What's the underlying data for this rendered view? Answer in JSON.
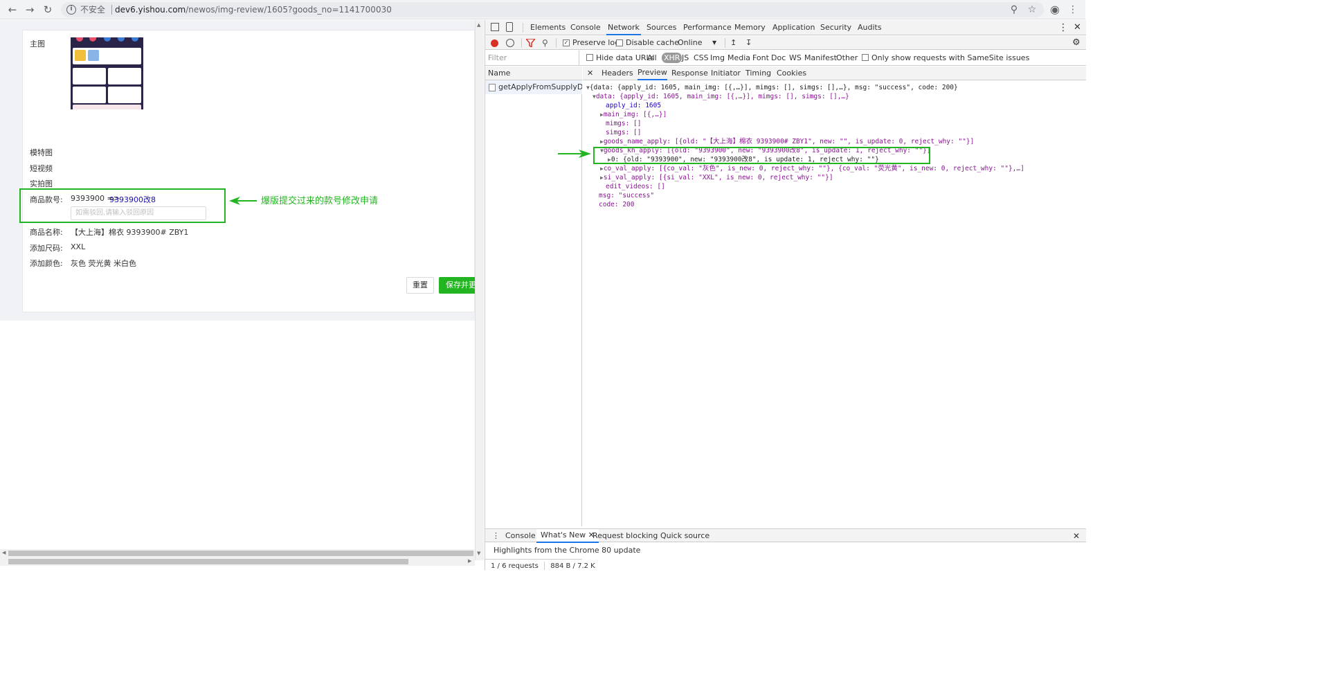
{
  "browser": {
    "insecure_label": "不安全",
    "url_host": "dev6.yishou.com",
    "url_path": "/newos/img-review/1605?goods_no=1141700030"
  },
  "form": {
    "main_image_label": "主图",
    "model_image_label": "模特图",
    "short_video_label": "短视频",
    "real_photo_label": "实拍图",
    "kh_label": "商品款号:",
    "kh_old": "9393900 =>",
    "kh_new": "9393900改8",
    "reject_placeholder": "如需驳回,请输入驳回原因",
    "name_label": "商品名称:",
    "name_value": "【大上海】棉衣 9393900# ZBY1",
    "size_label": "添加尺码:",
    "size_value": "XXL",
    "color_label": "添加颜色:",
    "color_value": "灰色 荧光黄 米白色",
    "reset_button": "重置",
    "save_button": "保存并更"
  },
  "annotation": {
    "text": "爆版提交过来的款号修改申请"
  },
  "devtools": {
    "tabs": [
      "Elements",
      "Console",
      "Network",
      "Sources",
      "Performance",
      "Memory",
      "Application",
      "Security",
      "Audits"
    ],
    "preserve_log": "Preserve log",
    "disable_cache": "Disable cache",
    "throttle": "Online",
    "filter_placeholder": "Filter",
    "hide_data_urls": "Hide data URLs",
    "type_filters": [
      "All",
      "XHR",
      "JS",
      "CSS",
      "Img",
      "Media",
      "Font",
      "Doc",
      "WS",
      "Manifest",
      "Other"
    ],
    "samesite": "Only show requests with SameSite issues",
    "name_header": "Name",
    "request_name": "getApplyFromSupplyDetail",
    "detail_tabs": [
      "Headers",
      "Preview",
      "Response",
      "Initiator",
      "Timing",
      "Cookies"
    ],
    "status_requests": "1 / 6 requests",
    "status_size": "884 B / 7.2 K",
    "drawer_tabs": [
      "Console",
      "What's New",
      "Request blocking",
      "Quick source"
    ],
    "drawer_message": "Highlights from the Chrome 80 update",
    "json_lines": [
      "{data: {apply_id: 1605, main_img: [{,…}], mimgs: [], simgs: [],…}, msg: \"success\", code: 200}",
      "data: {apply_id: 1605, main_img: [{,…}], mimgs: [], simgs: [],…}",
      "apply_id: 1605",
      "main_img: [{,…}]",
      "mimgs: []",
      "simgs: []",
      "goods_name_apply: [{old: \"【大上海】棉衣 9393900# ZBY1\", new: \"\", is_update: 0, reject_why: \"\"}]",
      "goods_kh_apply: [{old: \"9393900\", new: \"9393900改8\", is_update: 1, reject_why: \"\"}]",
      "0: {old: \"9393900\", new: \"9393900改8\", is_update: 1, reject_why: \"\"}",
      "co_val_apply: [{co_val: \"灰色\", is_new: 0, reject_why: \"\"}, {co_val: \"荧光黄\", is_new: 0, reject_why: \"\"},…]",
      "si_val_apply: [{si_val: \"XXL\", is_new: 0, reject_why: \"\"}]",
      "edit_videos: []",
      "msg: \"success\"",
      "code: 200"
    ]
  },
  "colors": {
    "highlight_green": "#22b521",
    "link_blue": "#1a0dab",
    "devtools_active": "#1a73e8"
  }
}
